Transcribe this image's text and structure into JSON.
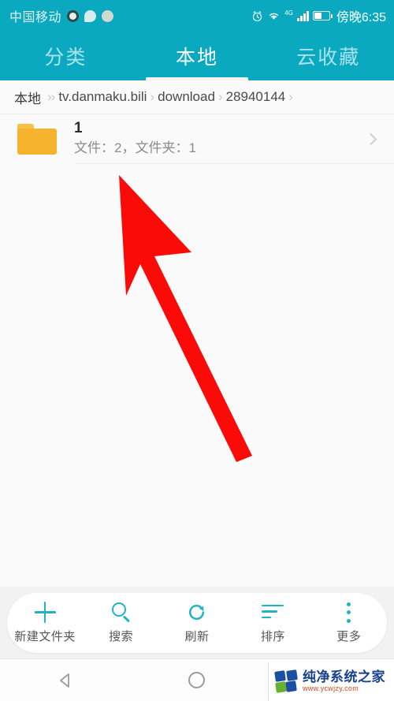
{
  "statusbar": {
    "carrier": "中国移动",
    "time": "傍晚6:35",
    "network_label": "4G",
    "icons": [
      "app-badge-icon",
      "message-bubble-icon",
      "app-pale-icon",
      "alarm-clock-icon",
      "wifi-icon",
      "signal-bars-icon",
      "battery-icon"
    ]
  },
  "tabs": [
    {
      "label": "分类",
      "active": false
    },
    {
      "label": "本地",
      "active": true
    },
    {
      "label": "云收藏",
      "active": false
    }
  ],
  "breadcrumb": {
    "root": "本地",
    "items": [
      "tv.danmaku.bili",
      "download",
      "28940144"
    ],
    "separator": "›"
  },
  "files": [
    {
      "name": "1",
      "subtitle": "文件：2，文件夹：1",
      "icon": "folder-icon",
      "icon_color": "#f5b32e"
    }
  ],
  "toolbar": [
    {
      "label": "新建文件夹",
      "icon": "plus-icon"
    },
    {
      "label": "搜索",
      "icon": "search-icon"
    },
    {
      "label": "刷新",
      "icon": "refresh-icon"
    },
    {
      "label": "排序",
      "icon": "sort-icon"
    },
    {
      "label": "更多",
      "icon": "more-vertical-icon"
    }
  ],
  "navbar": {
    "back": "back-triangle-icon",
    "home": "home-circle-icon"
  },
  "watermark": {
    "title": "纯净系统之家",
    "url": "www.ycwjzy.com"
  },
  "annotation": {
    "arrow": "red-pointer-arrow",
    "color": "#fb0b08"
  },
  "colors": {
    "header_teal": "#0ba9c0",
    "accent_cyan": "#1fb4c4",
    "folder_amber": "#f5b32e",
    "page_bg": "#f2f2f2",
    "list_bg": "#fafafa"
  }
}
